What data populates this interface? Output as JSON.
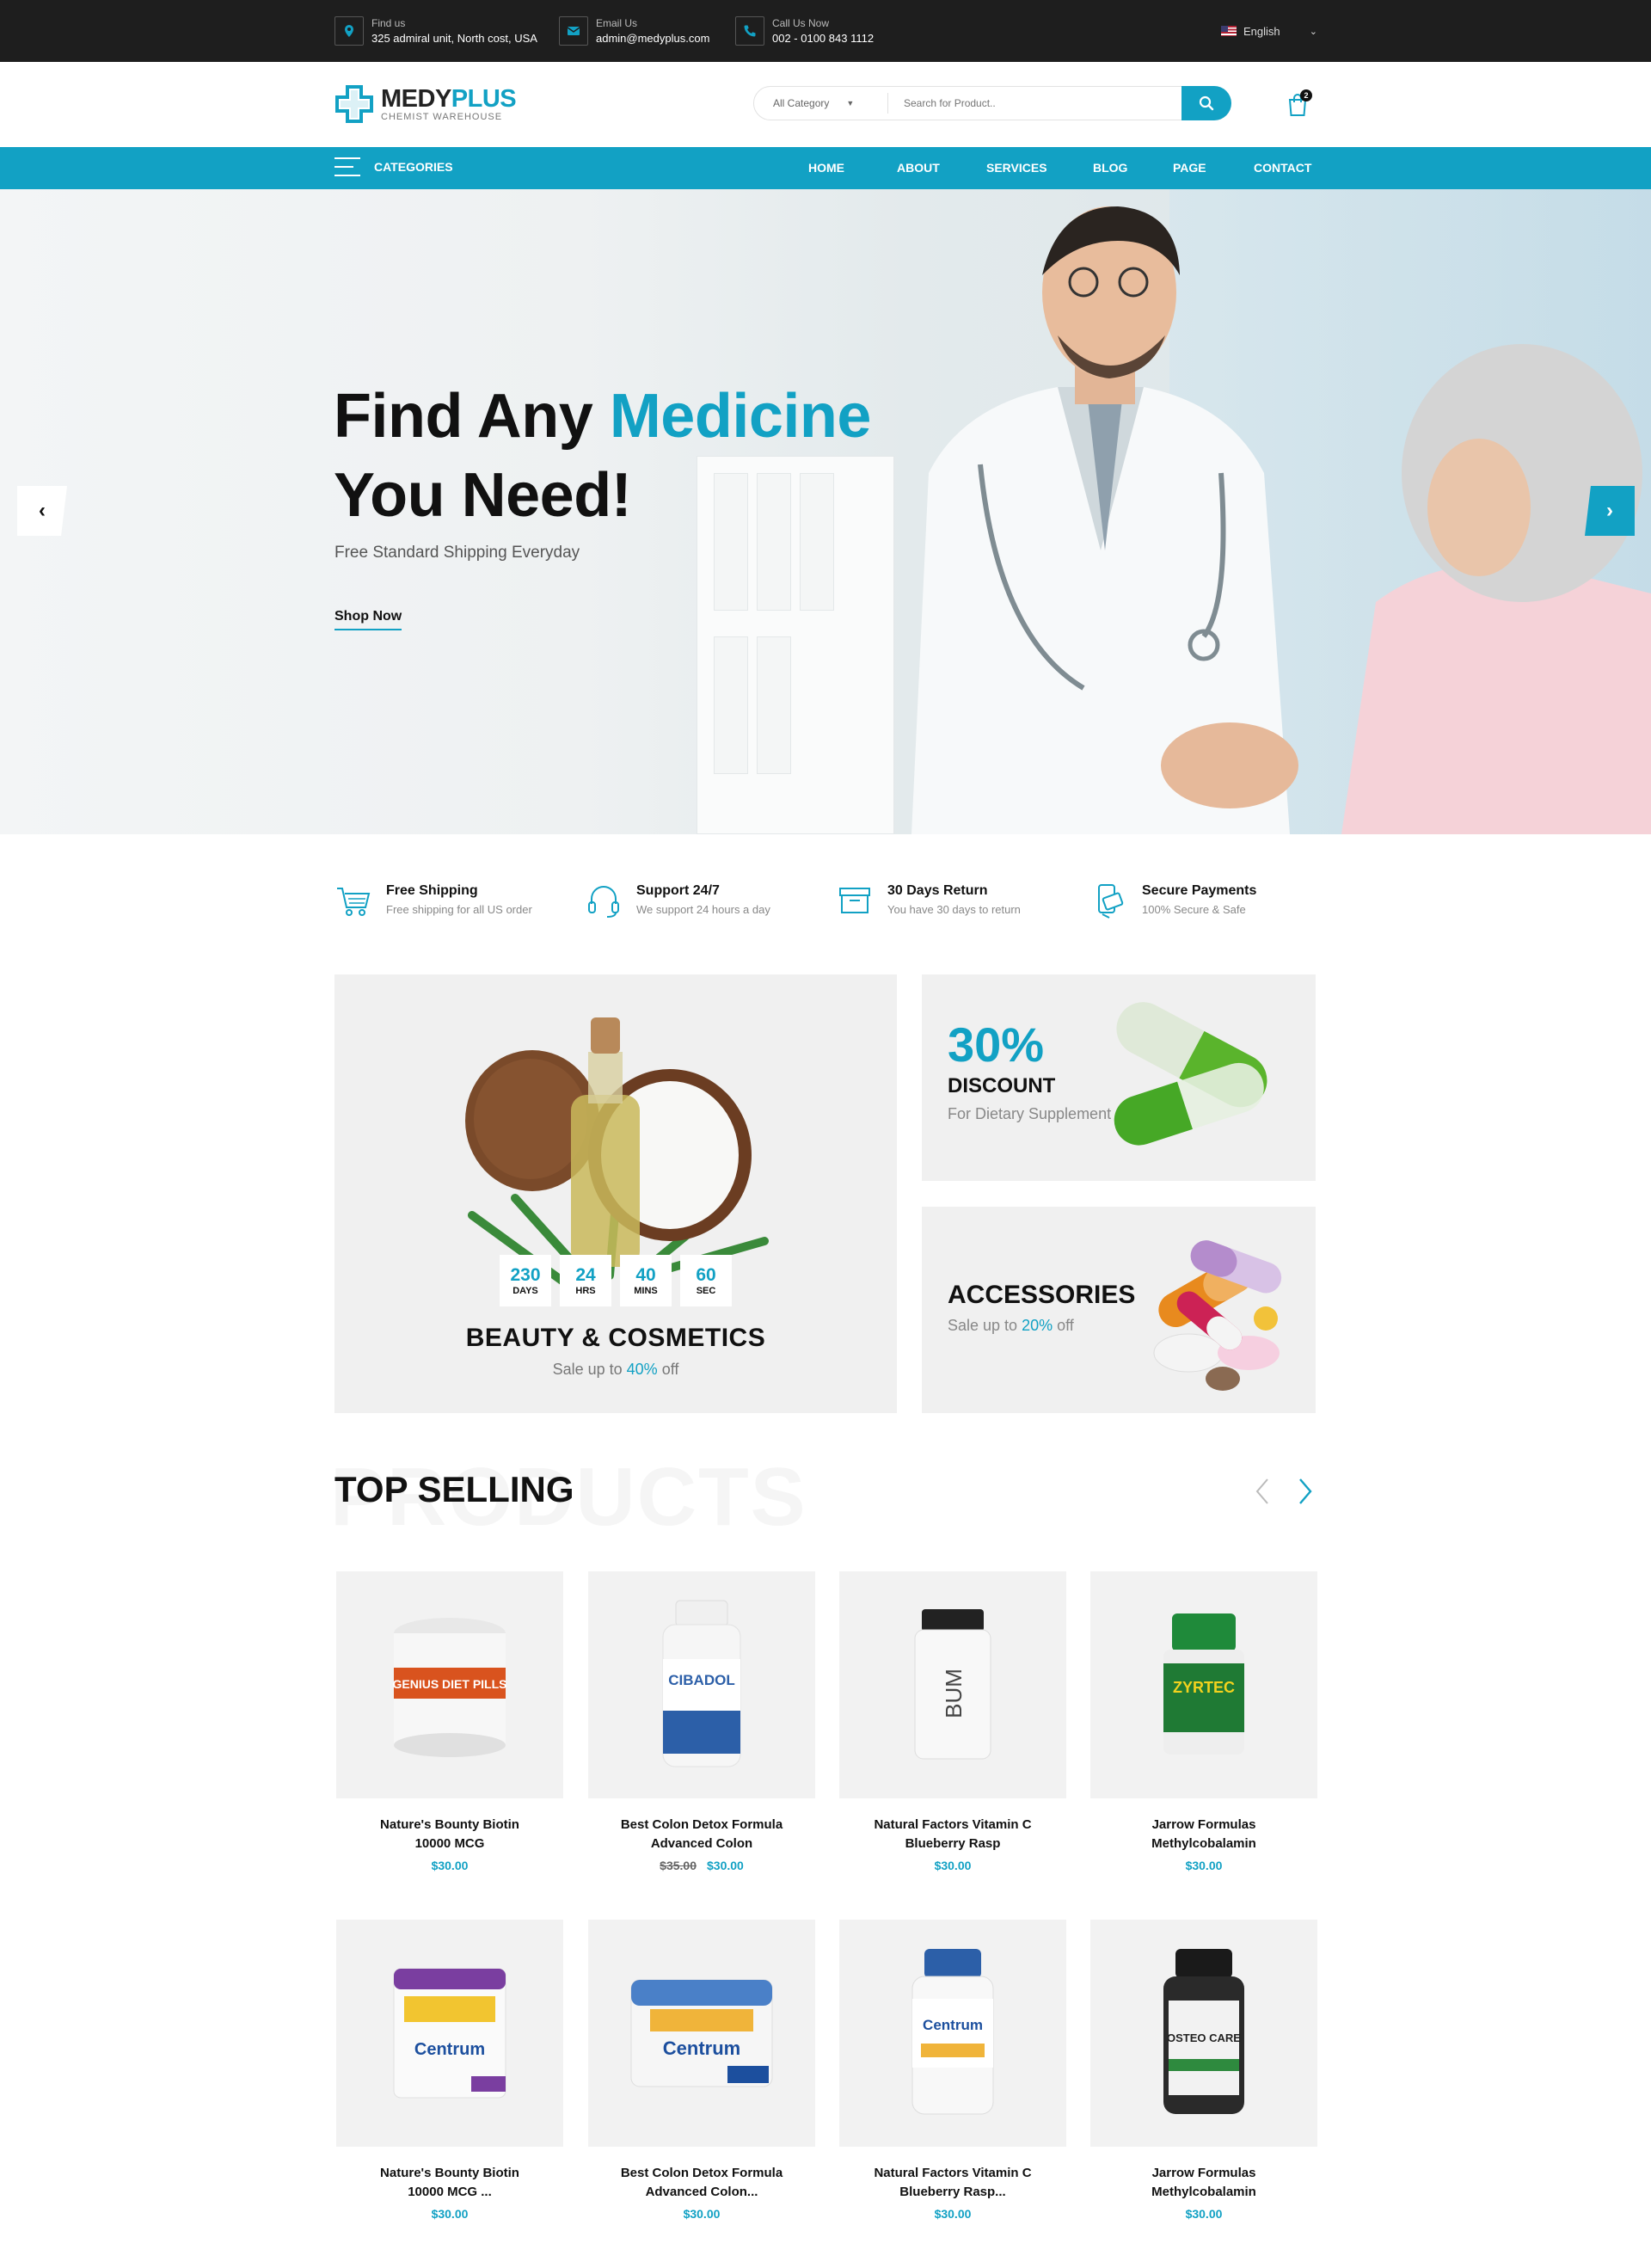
{
  "topbar": {
    "find_label": "Find us",
    "find_value": "325 admiral unit, North cost, USA",
    "email_label": "Email Us",
    "email_value": "admin@medyplus.com",
    "call_label": "Call Us Now",
    "call_value": "002 - 0100 843 1112",
    "language": "English"
  },
  "header": {
    "logo_part1": "MEDY",
    "logo_part2": "PLUS",
    "logo_tagline": "CHEMIST WAREHOUSE",
    "category_select": "All Category",
    "search_placeholder": "Search for Product..",
    "cart_count": "2"
  },
  "nav": {
    "categories_label": "CATEGORIES",
    "links": [
      "HOME",
      "ABOUT",
      "SERVICES",
      "BLOG",
      "PAGE",
      "CONTACT"
    ]
  },
  "hero": {
    "title_part1": "Find Any ",
    "title_highlight": "Medicine",
    "title_part2": "You Need!",
    "subtitle": "Free Standard Shipping Everyday",
    "button": "Shop Now"
  },
  "features": [
    {
      "title": "Free Shipping",
      "desc": "Free shipping for all US order",
      "icon": "cart-icon"
    },
    {
      "title": "Support 24/7",
      "desc": "We support 24 hours a day",
      "icon": "headset-icon"
    },
    {
      "title": "30 Days Return",
      "desc": "You have 30 days to return",
      "icon": "return-box-icon"
    },
    {
      "title": "Secure Payments",
      "desc": "100% Secure & Safe",
      "icon": "secure-payment-icon"
    }
  ],
  "banners": {
    "beauty": {
      "countdown": [
        {
          "value": "230",
          "label": "DAYS"
        },
        {
          "value": "24",
          "label": "HRS"
        },
        {
          "value": "40",
          "label": "MINS"
        },
        {
          "value": "60",
          "label": "SEC"
        }
      ],
      "title": "BEAUTY & COSMETICS",
      "sub_prefix": "Sale up to ",
      "sub_highlight": "40%",
      "sub_suffix": " off"
    },
    "discount": {
      "percent": "30%",
      "title": "DISCOUNT",
      "sub": "For Dietary Supplement"
    },
    "accessories": {
      "title": "ACCESSORIES",
      "sub_prefix": "Sale up to ",
      "sub_highlight": "20%",
      "sub_suffix": " off"
    }
  },
  "top_selling": {
    "ghost_text": "PRODUCTS",
    "title": "TOP SELLING",
    "products": [
      {
        "name_line1": "Nature's Bounty Biotin",
        "name_line2": "10000 MCG",
        "old_price": "",
        "price": "$30.00",
        "label": "GENIUS DIET PILLS"
      },
      {
        "name_line1": "Best Colon Detox Formula",
        "name_line2": "Advanced Colon",
        "old_price": "$35.00",
        "price": "$30.00",
        "label": "CIBADOL"
      },
      {
        "name_line1": "Natural Factors Vitamin C",
        "name_line2": "Blueberry Rasp",
        "old_price": "",
        "price": "$30.00",
        "label": "BUM"
      },
      {
        "name_line1": "Jarrow Formulas",
        "name_line2": "Methylcobalamin",
        "old_price": "",
        "price": "$30.00",
        "label": "ZYRTEC"
      },
      {
        "name_line1": "Nature's Bounty Biotin",
        "name_line2": "10000 MCG ...",
        "old_price": "",
        "price": "$30.00",
        "label": "Centrum"
      },
      {
        "name_line1": "Best Colon Detox Formula",
        "name_line2": "Advanced Colon...",
        "old_price": "",
        "price": "$30.00",
        "label": "Centrum"
      },
      {
        "name_line1": "Natural Factors Vitamin C",
        "name_line2": "Blueberry Rasp...",
        "old_price": "",
        "price": "$30.00",
        "label": "Centrum"
      },
      {
        "name_line1": "Jarrow Formulas",
        "name_line2": "Methylcobalamin",
        "old_price": "",
        "price": "$30.00",
        "label": "OSTEO CARE"
      }
    ]
  },
  "colors": {
    "accent": "#12a1c4",
    "topbar": "#1e1e1e",
    "panel": "#f0f0f0"
  }
}
